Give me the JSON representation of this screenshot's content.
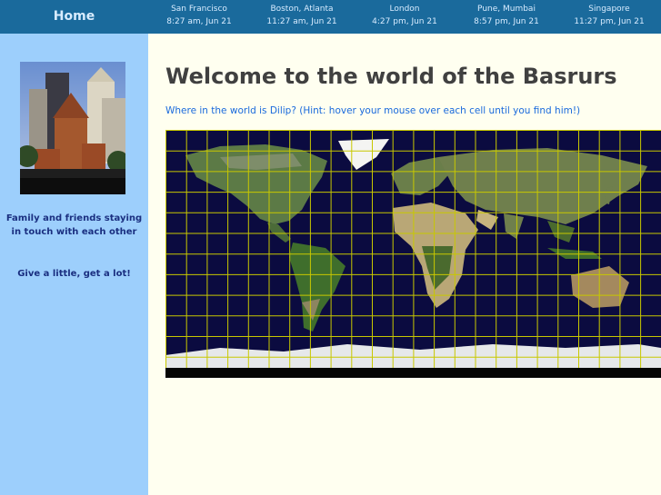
{
  "nav": {
    "home_label": "Home",
    "clocks": [
      {
        "city": "San Francisco",
        "time": "8:27 am, Jun 21"
      },
      {
        "city": "Boston, Atlanta",
        "time": "11:27 am, Jun 21"
      },
      {
        "city": "London",
        "time": "4:27 pm, Jun 21"
      },
      {
        "city": "Pune, Mumbai",
        "time": "8:57 pm, Jun 21"
      },
      {
        "city": "Singapore",
        "time": "11:27 pm, Jun 21"
      }
    ]
  },
  "sidebar": {
    "tagline": "Family and friends staying in touch with each other",
    "motto": "Give a little, get a lot!"
  },
  "main": {
    "title": "Welcome to the world of the Basrurs",
    "hint": "Where in the world is Dilip? (Hint: hover your mouse over each cell until you find him!)"
  },
  "colors": {
    "topbar": "#1a6a9c",
    "sidebar": "#9dcffc",
    "page": "#fffff0",
    "grid": "#c8c800",
    "ocean": "#0b0b40"
  }
}
